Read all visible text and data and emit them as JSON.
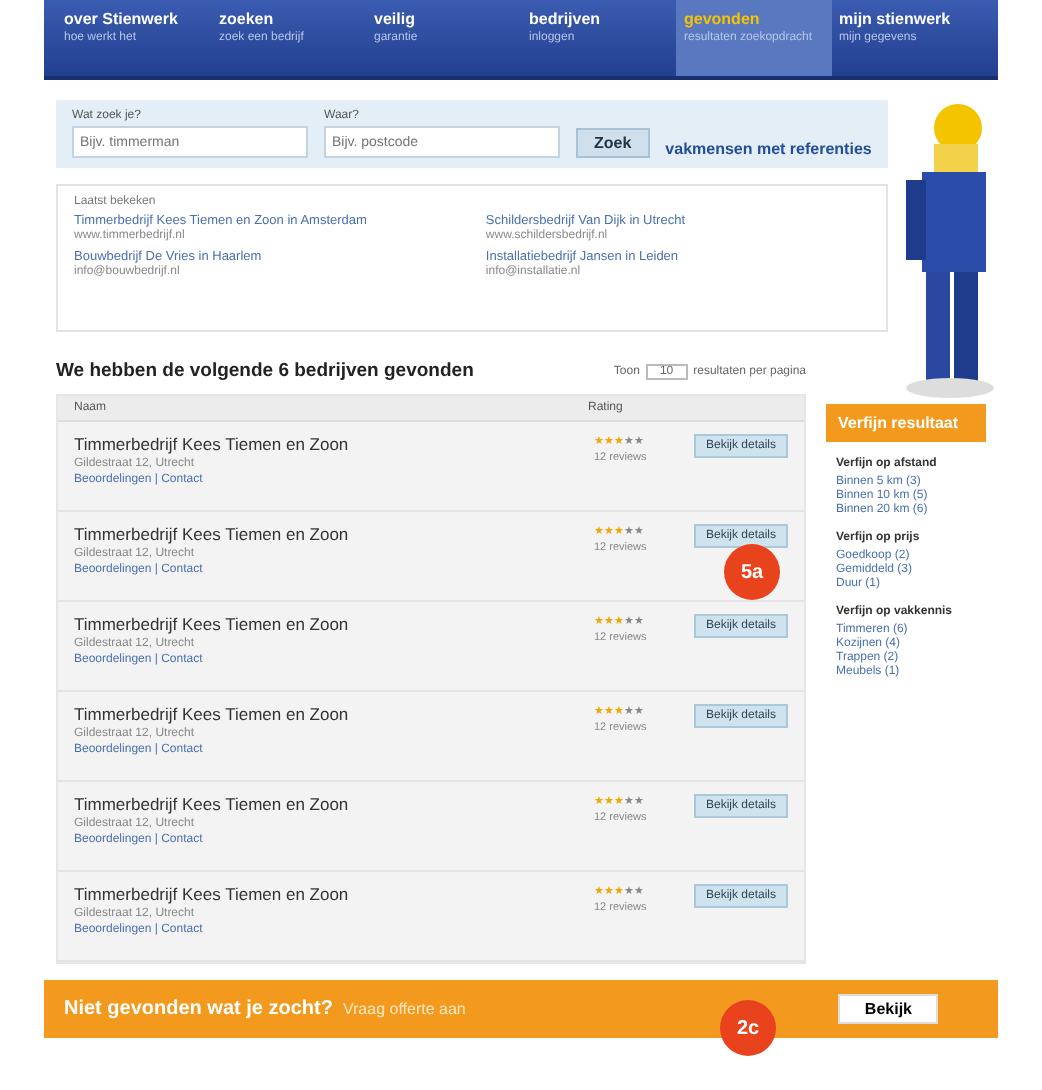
{
  "nav": [
    {
      "label": "over Stienwerk",
      "sub": "hoe werkt het",
      "selected": false
    },
    {
      "label": "zoeken",
      "sub": "zoek een bedrijf",
      "selected": false
    },
    {
      "label": "veilig",
      "sub": "garantie",
      "selected": false
    },
    {
      "label": "bedrijven",
      "sub": "inloggen",
      "selected": false
    },
    {
      "label": "gevonden",
      "sub": "resultaten zoekopdracht",
      "selected": true
    },
    {
      "label": "mijn stienwerk",
      "sub": "mijn gegevens",
      "selected": false
    }
  ],
  "search": {
    "what_label": "Wat zoek je?",
    "what_placeholder": "Bijv. timmerman",
    "where_label": "Waar?",
    "where_placeholder": "Bijv. postcode",
    "button": "Zoek",
    "promo": "vakmensen met referenties"
  },
  "recent": {
    "title": "Laatst bekeken",
    "items": [
      {
        "text": "Timmerbedrijf Kees Tiemen en Zoon in Amsterdam",
        "meta": "www.timmerbedrijf.nl"
      },
      {
        "text": "Schildersbedrijf Van Dijk in Utrecht",
        "meta": "www.schildersbedrijf.nl"
      },
      {
        "text": "Bouwbedrijf De Vries in Haarlem",
        "meta": "info@bouwbedrijf.nl"
      },
      {
        "text": "Installatiebedrijf Jansen in Leiden",
        "meta": "info@installatie.nl"
      }
    ]
  },
  "results": {
    "heading": "We hebben de volgende 6 bedrijven gevonden",
    "show_label": "Toon",
    "per_page": "10",
    "per_page_suffix": "resultaten per pagina",
    "columns": [
      "Naam",
      "Rating"
    ],
    "rows": [
      {
        "name": "Timmerbedrijf Kees Tiemen en Zoon",
        "address": "Gildestraat 12, Utrecht",
        "links": "Beoordelingen | Contact",
        "stars": 3,
        "reviews": "12 reviews",
        "button": "Bekijk details"
      },
      {
        "name": "Timmerbedrijf Kees Tiemen en Zoon",
        "address": "Gildestraat 12, Utrecht",
        "links": "Beoordelingen | Contact",
        "stars": 3,
        "reviews": "12 reviews",
        "button": "Bekijk details"
      },
      {
        "name": "Timmerbedrijf Kees Tiemen en Zoon",
        "address": "Gildestraat 12, Utrecht",
        "links": "Beoordelingen | Contact",
        "stars": 3,
        "reviews": "12 reviews",
        "button": "Bekijk details"
      },
      {
        "name": "Timmerbedrijf Kees Tiemen en Zoon",
        "address": "Gildestraat 12, Utrecht",
        "links": "Beoordelingen | Contact",
        "stars": 3,
        "reviews": "12 reviews",
        "button": "Bekijk details"
      },
      {
        "name": "Timmerbedrijf Kees Tiemen en Zoon",
        "address": "Gildestraat 12, Utrecht",
        "links": "Beoordelingen | Contact",
        "stars": 3,
        "reviews": "12 reviews",
        "button": "Bekijk details"
      },
      {
        "name": "Timmerbedrijf Kees Tiemen en Zoon",
        "address": "Gildestraat 12, Utrecht",
        "links": "Beoordelingen | Contact",
        "stars": 3,
        "reviews": "12 reviews",
        "button": "Bekijk details"
      }
    ]
  },
  "refine": {
    "title": "Verfijn resultaat",
    "groups": [
      {
        "title": "Verfijn op afstand",
        "links": [
          "Binnen 5 km (3)",
          "Binnen 10 km (5)",
          "Binnen 20 km (6)"
        ]
      },
      {
        "title": "Verfijn op prijs",
        "links": [
          "Goedkoop (2)",
          "Gemiddeld (3)",
          "Duur (1)"
        ]
      },
      {
        "title": "Verfijn op vakkennis",
        "links": [
          "Timmeren (6)",
          "Kozijnen (4)",
          "Trappen (2)",
          "Meubels (1)"
        ]
      }
    ]
  },
  "footer": {
    "bold": "Niet gevonden wat je zocht?",
    "text": "Vraag offerte aan",
    "button": "Bekijk"
  },
  "badges": [
    "5a",
    "2c"
  ]
}
